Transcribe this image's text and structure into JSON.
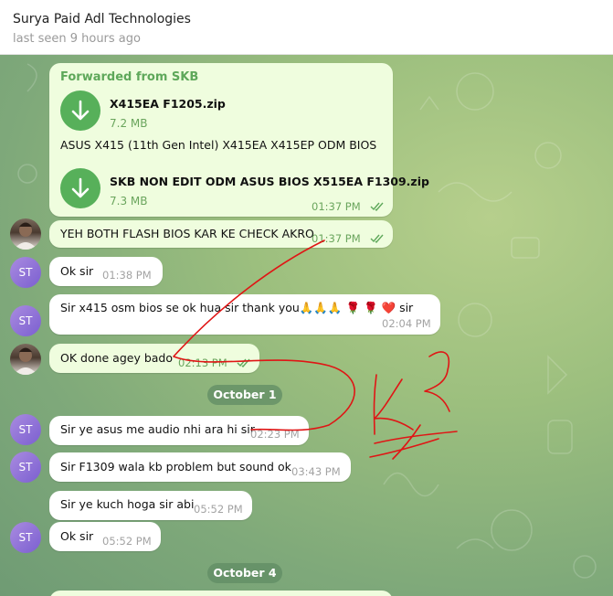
{
  "header": {
    "title": "Surya Paid Adl Technologies",
    "status": "last seen 9 hours ago"
  },
  "messages": {
    "fwd": {
      "forwarded": "Forwarded from SKB",
      "file1_name": "X415EA F1205.zip",
      "file1_size": "7.2 MB",
      "caption": "ASUS X415 (11th Gen Intel) X415EA X415EP ODM BIOS",
      "file2_name": "SKB NON EDIT ODM ASUS BIOS X515EA F1309.zip",
      "file2_size": "7.3 MB",
      "time": "01:37 PM"
    },
    "m1": {
      "text": "YEH BOTH FLASH BIOS KAR KE CHECK AKRO",
      "time": "01:37 PM"
    },
    "m2": {
      "text": "Ok sir",
      "time": "01:38 PM"
    },
    "m3": {
      "text": "Sir  x415 osm  bios se  ok hua  sir  thank you🙏🙏🙏 🌹 🌹 ❤️ sir",
      "time": "02:04 PM"
    },
    "m4": {
      "text": "OK done agey bado",
      "time": "02:13 PM"
    },
    "date1": "October 1",
    "m5": {
      "text": "Sir ye asus me audio nhi ara hi sir",
      "time": "02:23 PM"
    },
    "m6": {
      "text": "Sir F1309  wala kb problem but sound ok",
      "time": "03:43 PM"
    },
    "m7": {
      "text": "Sir ye kuch hoga sir abi",
      "time": "05:52 PM"
    },
    "m8": {
      "text": "Ok sir",
      "time": "05:52 PM"
    },
    "date2": "October 4"
  },
  "avatar_initials": "ST",
  "icons": {
    "download": "download-arrow-icon",
    "read": "double-check-icon"
  },
  "colors": {
    "outgoing_bubble": "#effdde",
    "incoming_bubble": "#ffffff",
    "accent": "#5ea85a",
    "scribble": "#e11"
  }
}
